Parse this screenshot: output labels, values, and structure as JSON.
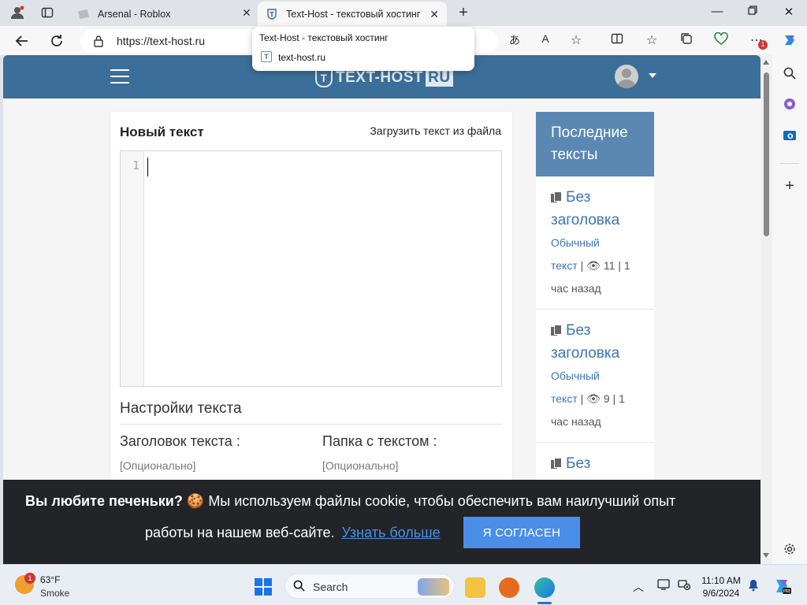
{
  "browser": {
    "tabs": [
      {
        "title": "Arsenal - Roblox",
        "active": false
      },
      {
        "title": "Text-Host - текстовый хостинг",
        "active": true
      }
    ],
    "url": "https://text-host.ru",
    "tooltip": {
      "title": "Text-Host - текстовый хостинг",
      "host": "text-host.ru"
    },
    "notifications_badge": "1"
  },
  "site": {
    "logo_text": "TEXT-HOST",
    "logo_suffix": "RU",
    "editor": {
      "title": "Новый текст",
      "upload_link": "Загрузить текст из файла",
      "line_number": "1"
    },
    "settings": {
      "title": "Настройки текста",
      "title_field_label": "Заголовок текста :",
      "title_field_hint": "[Опционально]",
      "folder_field_label": "Папка с текстом :",
      "folder_field_hint": "[Опционально]"
    },
    "recent": {
      "header": "Последние тексты",
      "items": [
        {
          "title_line1": "Без",
          "title_line2": "заголовка",
          "category_line1": "Обычный",
          "category_line2": "текст",
          "views": "11",
          "time_prefix": "1",
          "time_suffix": "час назад"
        },
        {
          "title_line1": "Без",
          "title_line2": "заголовка",
          "category_line1": "Обычный",
          "category_line2": "текст",
          "views": "9",
          "time_prefix": "1",
          "time_suffix": "час назад"
        },
        {
          "title_line1": "Без"
        }
      ]
    },
    "cookie": {
      "bold": "Вы любите печеньки?",
      "text1": "Мы используем файлы cookie, чтобы обеспечить вам наилучший опыт",
      "text2": "работы на нашем веб-сайте.",
      "learn_more": "Узнать больше",
      "agree": "Я СОГЛАСЕН"
    }
  },
  "taskbar": {
    "weather_badge": "1",
    "temperature": "63°F",
    "condition": "Smoke",
    "search_label": "Search",
    "time": "11:10 AM",
    "date": "9/6/2024"
  },
  "colors": {
    "header": "#3b6e98",
    "sidebar_header": "#5a88b3",
    "link": "#3b76b5",
    "cookie_bg": "#222428",
    "agree_button": "#4a8ee8"
  }
}
